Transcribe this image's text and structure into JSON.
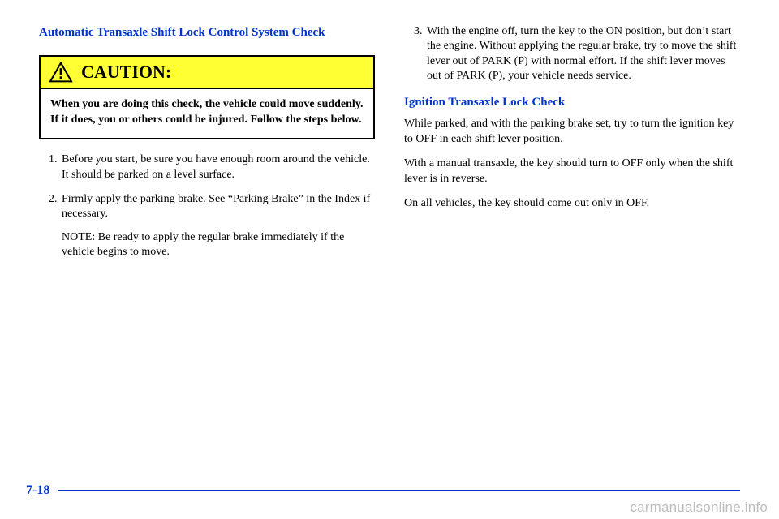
{
  "left": {
    "heading": "Automatic Transaxle Shift Lock Control System Check",
    "caution": {
      "label": "CAUTION:",
      "body": "When you are doing this check, the vehicle could move suddenly. If it does, you or others could be injured. Follow the steps below."
    },
    "steps": {
      "s1": "Before you start, be sure you have enough room around the vehicle. It should be parked on a level surface.",
      "s2": "Firmly apply the parking brake. See “Parking Brake” in the Index if necessary.",
      "s2_note": "NOTE: Be ready to apply the regular brake immediately if the vehicle begins to move."
    }
  },
  "right": {
    "step3": "With the engine off, turn the key to the ON position, but don’t start the engine. Without applying the regular brake, try to move the shift lever out of PARK (P) with normal effort. If the shift lever moves out of PARK (P), your vehicle needs service.",
    "heading2": "Ignition Transaxle Lock Check",
    "p1": "While parked, and with the parking brake set, try to turn the ignition key to OFF in each shift lever position.",
    "p2": "With a manual transaxle, the key should turn to OFF only when the shift lever is in reverse.",
    "p3": "On all vehicles, the key should come out only in OFF."
  },
  "footer": {
    "page": "7-18"
  },
  "watermark": "carmanualsonline.info"
}
